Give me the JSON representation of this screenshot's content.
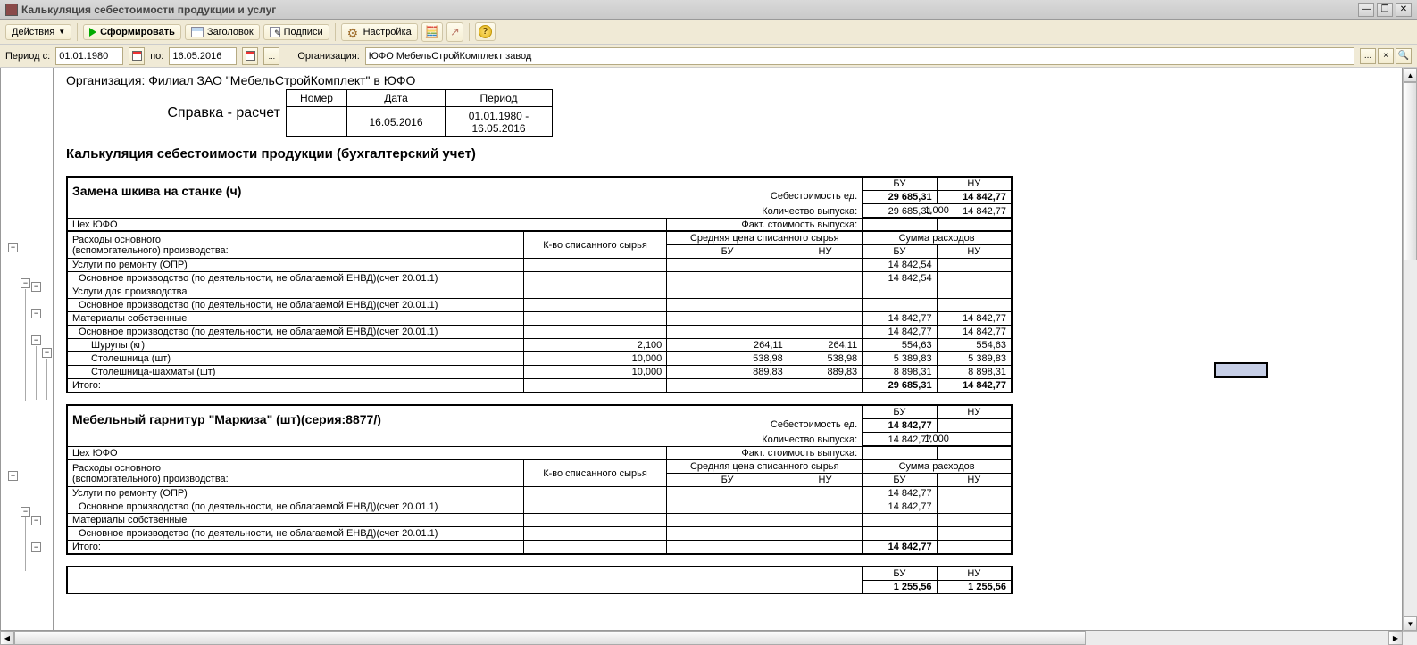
{
  "window_title": "Калькуляция себестоимости продукции и услуг",
  "toolbar": {
    "actions": "Действия",
    "form": "Сформировать",
    "header": "Заголовок",
    "signatures": "Подписи",
    "settings": "Настройка"
  },
  "filter": {
    "period_from_label": "Период с:",
    "to_label": "по:",
    "date_from": "01.01.1980",
    "date_to": "16.05.2016",
    "org_label": "Организация:",
    "org_value": "ЮФО МебельСтройКомплект завод"
  },
  "report": {
    "org_label": "Организация:",
    "org_name": "Филиал ЗАО \"МебельСтройКомплект\" в ЮФО",
    "ref_title": "Справка - расчет",
    "ref_headers": {
      "num": "Номер",
      "date": "Дата",
      "period": "Период"
    },
    "ref_values": {
      "num": "",
      "date": "16.05.2016",
      "period": "01.01.1980 - 16.05.2016"
    },
    "title": "Калькуляция себестоимости продукции (бухгалтерский учет)",
    "labels": {
      "bu": "БУ",
      "nu": "НУ",
      "cost_per_unit": "Себестоимость ед.",
      "output_qty": "Количество выпуска:",
      "actual_output_cost": "Факт. стоимость выпуска:",
      "main_aux_costs_l1": "Расходы основного",
      "main_aux_costs_l2": "(вспомогательного) производства:",
      "qty_written": "К-во списанного сырья",
      "avg_price_written": "Средняя цена списанного сырья",
      "cost_sum": "Сумма расходов",
      "total": "Итого:"
    },
    "products": [
      {
        "name": "Замена шкива на станке (ч)",
        "workshop": "Цех ЮФО",
        "cost_bu": "29 685,31",
        "cost_nu": "14 842,77",
        "qty": "1,000",
        "fact_bu": "29 685,31",
        "fact_nu": "14 842,77",
        "groups": [
          {
            "name": "Услуги по ремонту (ОПР)",
            "bu": "14 842,54",
            "nu": "",
            "sub": [
              {
                "name": "Основное производство (по деятельности, не облагаемой ЕНВД)(счет 20.01.1)",
                "bu": "14 842,54",
                "nu": ""
              }
            ]
          },
          {
            "name": "Услуги для производства",
            "bu": "",
            "nu": "",
            "sub": [
              {
                "name": "Основное производство (по деятельности, не облагаемой ЕНВД)(счет 20.01.1)",
                "bu": "",
                "nu": ""
              }
            ]
          },
          {
            "name": "Материалы собственные",
            "bu": "14 842,77",
            "nu": "14 842,77",
            "sub": [
              {
                "name": "Основное производство (по деятельности, не облагаемой ЕНВД)(счет 20.01.1)",
                "bu": "14 842,77",
                "nu": "14 842,77"
              }
            ],
            "materials": [
              {
                "name": "Шурупы (кг)",
                "qty": "2,100",
                "avg_bu": "264,11",
                "avg_nu": "264,11",
                "sum_bu": "554,63",
                "sum_nu": "554,63"
              },
              {
                "name": "Столешница (шт)",
                "qty": "10,000",
                "avg_bu": "538,98",
                "avg_nu": "538,98",
                "sum_bu": "5 389,83",
                "sum_nu": "5 389,83"
              },
              {
                "name": "Столешница-шахматы (шт)",
                "qty": "10,000",
                "avg_bu": "889,83",
                "avg_nu": "889,83",
                "sum_bu": "8 898,31",
                "sum_nu": "8 898,31"
              }
            ]
          }
        ],
        "total_bu": "29 685,31",
        "total_nu": "14 842,77"
      },
      {
        "name": "Мебельный гарнитур \"Маркиза\" (шт)(серия:8877/)",
        "workshop": "Цех ЮФО",
        "cost_bu": "14 842,77",
        "cost_nu": "",
        "qty": "1,000",
        "fact_bu": "14 842,77",
        "fact_nu": "",
        "groups": [
          {
            "name": "Услуги по ремонту (ОПР)",
            "bu": "14 842,77",
            "nu": "",
            "sub": [
              {
                "name": "Основное производство (по деятельности, не облагаемой ЕНВД)(счет 20.01.1)",
                "bu": "14 842,77",
                "nu": ""
              }
            ]
          },
          {
            "name": "Материалы собственные",
            "bu": "",
            "nu": "",
            "sub": [
              {
                "name": "Основное производство (по деятельности, не облагаемой ЕНВД)(счет 20.01.1)",
                "bu": "",
                "nu": ""
              }
            ]
          }
        ],
        "total_bu": "14 842,77",
        "total_nu": ""
      }
    ],
    "partial_next": {
      "bu": "1 255,56",
      "nu": "1 255,56"
    }
  }
}
